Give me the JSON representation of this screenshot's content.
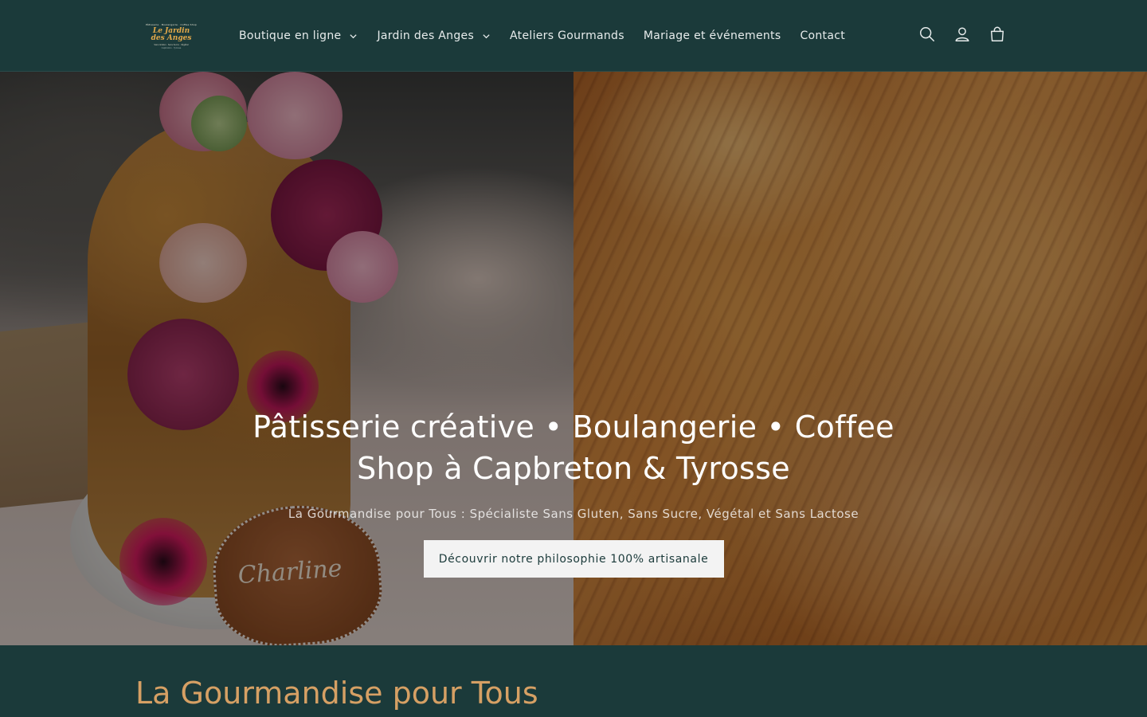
{
  "header": {
    "logo": {
      "top_text": "Pâtisserie · Boulangerie · Coffee Shop",
      "main_line1": "Le Jardin",
      "main_line2": "des Anges",
      "bottom_text": "Sans Gluten · Sans Sucre · Végétal",
      "sub_text": "Capbreton · Tyrosse"
    },
    "nav": [
      {
        "label": "Boutique en ligne",
        "has_dropdown": true
      },
      {
        "label": "Jardin des Anges",
        "has_dropdown": true
      },
      {
        "label": "Ateliers Gourmands",
        "has_dropdown": false
      },
      {
        "label": "Mariage et événements",
        "has_dropdown": false
      },
      {
        "label": "Contact",
        "has_dropdown": false
      }
    ],
    "icons": [
      "search-icon",
      "account-icon",
      "cart-icon"
    ]
  },
  "hero": {
    "title": "Pâtisserie créative • Boulangerie • Coffee Shop à Capbreton & Tyrosse",
    "subtitle": "La Gourmandise pour Tous : Spécialiste Sans Gluten, Sans Sucre, Végétal et Sans Lactose",
    "button_label": "Découvrir notre philosophie 100% artisanale",
    "plaque_text": "Charline"
  },
  "section": {
    "title": "La Gourmandise pour Tous"
  },
  "colors": {
    "header_bg": "#1b3a3a",
    "accent_title": "#d6a064",
    "button_bg": "#f3f3f3",
    "button_text": "#1b3a3a"
  }
}
